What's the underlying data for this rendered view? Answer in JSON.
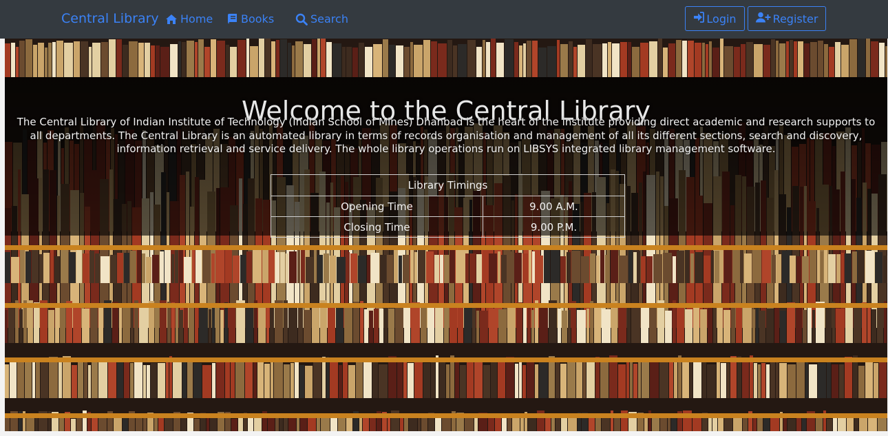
{
  "nav": {
    "brand": "Central Library",
    "links": [
      {
        "label": "Home",
        "icon": "home-icon"
      },
      {
        "label": "Books",
        "icon": "book-icon"
      },
      {
        "label": "Search",
        "icon": "search-icon"
      }
    ],
    "login_label": "Login",
    "register_label": "Register"
  },
  "hero": {
    "title": "Welcome to the Central Library",
    "description": "The Central Library of Indian Institute of Technology (Indian School of Mines) Dhanbad is the heart of the institute providing direct academic and research supports to all departments. The Central Library is an automated library in terms of records organisation and management of all its different sections, search and discovery, information retrieval and service delivery. The whole library operations run on LIBSYS integrated library management software."
  },
  "timings": {
    "header": "Library Timings",
    "rows": [
      {
        "label": "Opening Time",
        "value": "9.00 A.M."
      },
      {
        "label": "Closing Time",
        "value": "9.00 P.M."
      }
    ]
  },
  "colors": {
    "navbar": "#343a40",
    "accent": "#3b82f6",
    "shelf": "#c9821f"
  }
}
